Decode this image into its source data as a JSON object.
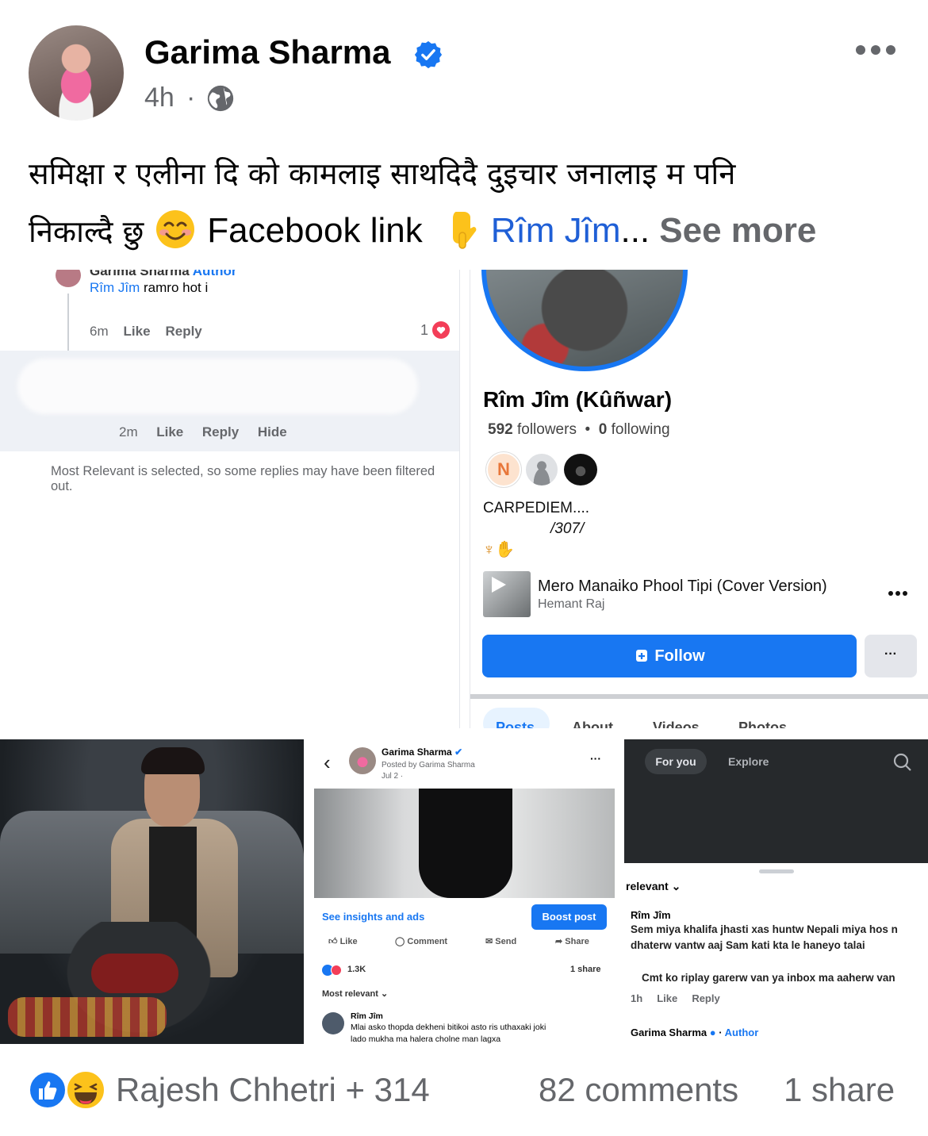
{
  "post": {
    "author": "Garima Sharma",
    "time": "4h",
    "dot": "·",
    "caption_line1": "समिक्षा र एलीना दि को कामलाइ साथदिदै दुइचार जनालाइ म पनि",
    "caption_line2_a": "निकाल्दै छु",
    "caption_line2_b": "Facebook link",
    "caption_link": "Rîm Jîm",
    "caption_ellipsis": "...",
    "see_more": "See more"
  },
  "img1": {
    "top_author": "Garima Sharma",
    "top_author_tag": "Author",
    "top_reply_name": "Rîm Jîm",
    "top_reply_text": "ramro hot i",
    "time1": "6m",
    "like": "Like",
    "reply": "Reply",
    "hide": "Hide",
    "likes_count": "1",
    "time2": "2m",
    "notice": "Most Relevant is selected, so some replies may have been filtered out."
  },
  "img2": {
    "name": "Rîm Jîm (Kûñwar)",
    "followers_count": "592",
    "followers_label": "followers",
    "following_count": "0",
    "following_label": "following",
    "bullet": "•",
    "mutual_initial": "N",
    "bio1": "CARPEDIEM....",
    "bio2": "/307/",
    "song_title": "Mero Manaiko Phool Tipi (Cover Version)",
    "song_artist": "Hemant Raj",
    "follow": "Follow",
    "more": "···",
    "tabs": [
      "Posts",
      "About",
      "Videos",
      "Photos"
    ]
  },
  "img4": {
    "author": "Garima Sharma",
    "posted_by": "Posted by Garima Sharma",
    "date": "Jul 2 ·",
    "insights": "See insights and ads",
    "boost": "Boost post",
    "like": "Like",
    "comment": "Comment",
    "send": "Send",
    "share": "Share",
    "reactions": "1.3K",
    "shares": "1 share",
    "most_relevant": "Most relevant",
    "commenter": "Rîm Jîm",
    "comment_text1": "Mlai asko thopda dekheni bitikoi asto ris uthaxaki joki",
    "comment_text2": "lado mukha ma halera cholne man lagxa"
  },
  "img5": {
    "tab1": "For you",
    "tab2": "Explore",
    "relevant": "relevant",
    "commenter": "Rîm Jîm",
    "comment1": "Sem miya khalifa jhasti xas huntw Nepali miya hos n",
    "comment2": "dhaterw vantw aaj Sam kati kta le haneyo talai",
    "comment3": "Cmt ko riplay garerw van ya inbox ma aaherw van",
    "time": "1h",
    "like": "Like",
    "reply": "Reply",
    "author": "Garima Sharma",
    "author_tag": "Author"
  },
  "footer": {
    "reactors": "Rajesh Chhetri + 314",
    "comments": "82 comments",
    "shares": "1 share"
  },
  "colors": {
    "fb_blue": "#1877f2",
    "text": "#050505",
    "secondary": "#65676b",
    "heart": "#f33e58"
  }
}
